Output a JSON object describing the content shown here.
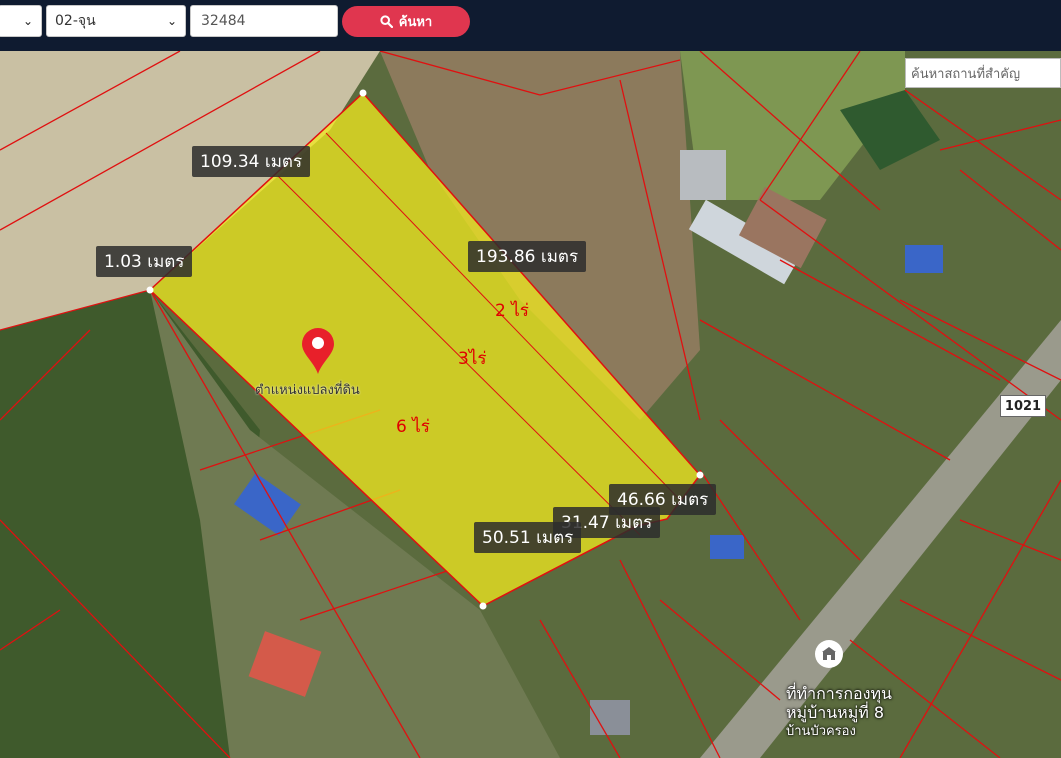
{
  "toolbar": {
    "province_value": "",
    "district_value": "02-จุน",
    "parcel_number": "32484",
    "search_label": "ค้นหา"
  },
  "map": {
    "place_search_placeholder": "ค้นหาสถานที่สำคัญ",
    "measurements": {
      "top_edge": "109.34 เมตร",
      "left_edge": "1.03 เมตร",
      "long_edge": "193.86 เมตร",
      "right_edge": "46.66 เมตร",
      "inner_edge": "31.47 เมตร",
      "bottom_edge": "50.51 เมตร"
    },
    "areas": {
      "strip_a": "2 ไร่",
      "strip_b": "3ไร่",
      "strip_c": "6 ไร่"
    },
    "parcel_label": "ตำแหน่งแปลงที่ดิน",
    "road_shield": "1021",
    "poi_lines": [
      "ที่ทำการกองทุน",
      "หมู่บ้านหมู่ที่ 8",
      "บ้านบัวครอง"
    ],
    "parcel_fill_color": "#f2ea1f",
    "boundary_color": "#e01010",
    "marker_color": "#e8202a"
  }
}
